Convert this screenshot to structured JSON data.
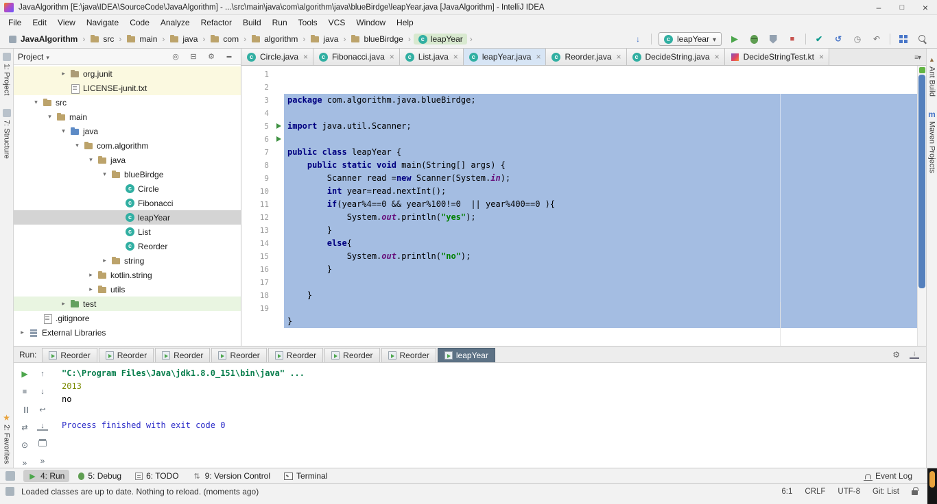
{
  "colors": {
    "selection_blue": "#A4BDE2",
    "keyword_navy": "#000080",
    "string_green": "#008000",
    "field_purple": "#660E7A",
    "run_green": "#4CA64C",
    "scrollbar_blue": "#3D6FB5",
    "active_run_tab": "#5D7285",
    "corner_orange": "#E8A33D"
  },
  "window": {
    "title": "JavaAlgorithm [E:\\java\\IDEA\\SourceCode\\JavaAlgorithm] - ...\\src\\main\\java\\com\\algorithm\\java\\blueBirdge\\leapYear.java [JavaAlgorithm] - IntelliJ IDEA"
  },
  "menu": {
    "items": [
      "File",
      "Edit",
      "View",
      "Navigate",
      "Code",
      "Analyze",
      "Refactor",
      "Build",
      "Run",
      "Tools",
      "VCS",
      "Window",
      "Help"
    ]
  },
  "toolbar": {
    "breadcrumbs": [
      {
        "label": "JavaAlgorithm",
        "icon": "project",
        "bold": true
      },
      {
        "label": "src",
        "icon": "folder"
      },
      {
        "label": "main",
        "icon": "folder"
      },
      {
        "label": "java",
        "icon": "folder"
      },
      {
        "label": "com",
        "icon": "folder"
      },
      {
        "label": "algorithm",
        "icon": "folder"
      },
      {
        "label": "java",
        "icon": "folder"
      },
      {
        "label": "blueBirdge",
        "icon": "folder"
      },
      {
        "label": "leapYear",
        "icon": "class",
        "highlight": true
      }
    ],
    "run_config": {
      "label": "leapYear"
    }
  },
  "activity_bars": {
    "left_top": [
      {
        "label": "1: Project",
        "icon": "project-tool"
      },
      {
        "label": "7: Structure",
        "icon": "structure-tool"
      }
    ],
    "left_bottom": [
      {
        "label": "2: Favorites",
        "icon": "favorites-star"
      }
    ],
    "right_top": [
      {
        "label": "Ant Build",
        "icon": "ant-tool"
      },
      {
        "label": "Maven Projects",
        "icon": "maven-tool"
      }
    ]
  },
  "project": {
    "header": "Project",
    "tree": [
      {
        "label": "org.junit",
        "depth": 3,
        "icon": "package",
        "chevron": "right",
        "row": "yellow"
      },
      {
        "label": "LICENSE-junit.txt",
        "depth": 3,
        "icon": "text-file",
        "row": "yellow"
      },
      {
        "label": "src",
        "depth": 1,
        "icon": "folder",
        "chevron": "down"
      },
      {
        "label": "main",
        "depth": 2,
        "icon": "folder",
        "chevron": "down"
      },
      {
        "label": "java",
        "depth": 3,
        "icon": "folder-source",
        "chevron": "down"
      },
      {
        "label": "com.algorithm",
        "depth": 4,
        "icon": "folder",
        "chevron": "down"
      },
      {
        "label": "java",
        "depth": 5,
        "icon": "folder",
        "chevron": "down"
      },
      {
        "label": "blueBirdge",
        "depth": 6,
        "icon": "folder",
        "chevron": "down"
      },
      {
        "label": "Circle",
        "depth": 7,
        "icon": "class"
      },
      {
        "label": "Fibonacci",
        "depth": 7,
        "icon": "class"
      },
      {
        "label": "leapYear",
        "depth": 7,
        "icon": "class",
        "selected": true
      },
      {
        "label": "List",
        "depth": 7,
        "icon": "class"
      },
      {
        "label": "Reorder",
        "depth": 7,
        "icon": "class"
      },
      {
        "label": "string",
        "depth": 6,
        "icon": "folder",
        "chevron": "right"
      },
      {
        "label": "kotlin.string",
        "depth": 5,
        "icon": "folder",
        "chevron": "right"
      },
      {
        "label": "utils",
        "depth": 5,
        "icon": "folder",
        "chevron": "right"
      },
      {
        "label": "test",
        "depth": 3,
        "icon": "folder-test",
        "chevron": "right",
        "row": "green"
      },
      {
        "label": ".gitignore",
        "depth": 1,
        "icon": "text-file"
      },
      {
        "label": "External Libraries",
        "depth": 0,
        "icon": "libraries",
        "chevron": "right"
      }
    ]
  },
  "editor": {
    "tabs": [
      {
        "label": "Circle.java",
        "icon": "java-class"
      },
      {
        "label": "Fibonacci.java",
        "icon": "java-class"
      },
      {
        "label": "List.java",
        "icon": "java-class"
      },
      {
        "label": "leapYear.java",
        "icon": "java-class",
        "active": true
      },
      {
        "label": "Reorder.java",
        "icon": "java-class"
      },
      {
        "label": "DecideString.java",
        "icon": "java-class"
      },
      {
        "label": "DecideStringTest.kt",
        "icon": "kotlin-file"
      }
    ],
    "selection_end_line": 18,
    "lines": [
      {
        "n": 1,
        "seg": [
          {
            "t": "package",
            "c": "kw"
          },
          {
            "t": " com.algorithm.java.blueBirdge;"
          }
        ]
      },
      {
        "n": 2,
        "seg": []
      },
      {
        "n": 3,
        "seg": [
          {
            "t": "import",
            "c": "kw"
          },
          {
            "t": " java.util.Scanner;"
          }
        ]
      },
      {
        "n": 4,
        "seg": []
      },
      {
        "n": 5,
        "run": true,
        "seg": [
          {
            "t": "public class",
            "c": "kw"
          },
          {
            "t": " leapYear {"
          }
        ]
      },
      {
        "n": 6,
        "run": true,
        "seg": [
          {
            "t": "    "
          },
          {
            "t": "public static void",
            "c": "kw"
          },
          {
            "t": " main(String[] args) {"
          }
        ]
      },
      {
        "n": 7,
        "seg": [
          {
            "t": "        Scanner read ="
          },
          {
            "t": "new",
            "c": "kw"
          },
          {
            "t": " Scanner(System."
          },
          {
            "t": "in",
            "c": "fld"
          },
          {
            "t": ");"
          }
        ]
      },
      {
        "n": 8,
        "seg": [
          {
            "t": "        "
          },
          {
            "t": "int",
            "c": "kw"
          },
          {
            "t": " year=read.nextInt();"
          }
        ]
      },
      {
        "n": 9,
        "seg": [
          {
            "t": "        "
          },
          {
            "t": "if",
            "c": "kw"
          },
          {
            "t": "(year%4==0 && year%100!=0  || year%400==0 ){"
          }
        ]
      },
      {
        "n": 10,
        "seg": [
          {
            "t": "            System."
          },
          {
            "t": "out",
            "c": "fld"
          },
          {
            "t": ".println("
          },
          {
            "t": "\"yes\"",
            "c": "str"
          },
          {
            "t": ");"
          }
        ]
      },
      {
        "n": 11,
        "seg": [
          {
            "t": "        }"
          }
        ]
      },
      {
        "n": 12,
        "seg": [
          {
            "t": "        "
          },
          {
            "t": "else",
            "c": "kw"
          },
          {
            "t": "{"
          }
        ]
      },
      {
        "n": 13,
        "seg": [
          {
            "t": "            System."
          },
          {
            "t": "out",
            "c": "fld"
          },
          {
            "t": ".println("
          },
          {
            "t": "\"no\"",
            "c": "str"
          },
          {
            "t": ");"
          }
        ]
      },
      {
        "n": 14,
        "seg": [
          {
            "t": "        }"
          }
        ]
      },
      {
        "n": 15,
        "seg": []
      },
      {
        "n": 16,
        "seg": [
          {
            "t": "    }"
          }
        ]
      },
      {
        "n": 17,
        "seg": []
      },
      {
        "n": 18,
        "seg": [
          {
            "t": "}"
          }
        ]
      },
      {
        "n": 19,
        "seg": []
      }
    ]
  },
  "run_panel": {
    "label": "Run:",
    "tabs": [
      {
        "label": "Reorder"
      },
      {
        "label": "Reorder"
      },
      {
        "label": "Reorder"
      },
      {
        "label": "Reorder"
      },
      {
        "label": "Reorder"
      },
      {
        "label": "Reorder"
      },
      {
        "label": "Reorder"
      },
      {
        "label": "leapYear",
        "active": true
      }
    ],
    "toolbar_left": [
      "rerun",
      "stop",
      "pause",
      "restore-layout",
      "pin",
      "more"
    ],
    "toolbar_right": [
      "prev-occurrence",
      "next-occurrence",
      "soft-wrap",
      "scroll-end",
      "print",
      "more"
    ],
    "console": [
      {
        "text": "\"C:\\Program Files\\Java\\jdk1.8.0_151\\bin\\java\" ...",
        "cls": "cmd"
      },
      {
        "text": "2013",
        "cls": "input"
      },
      {
        "text": "no",
        "cls": "out"
      },
      {
        "text": "",
        "cls": "blank"
      },
      {
        "text": "Process finished with exit code 0",
        "cls": "sys"
      }
    ]
  },
  "toolwindow_bar": {
    "items": [
      {
        "label": "4: Run",
        "icon": "run",
        "active": true
      },
      {
        "label": "5: Debug",
        "icon": "debug"
      },
      {
        "label": "6: TODO",
        "icon": "todo"
      },
      {
        "label": "9: Version Control",
        "icon": "vcs"
      },
      {
        "label": "Terminal",
        "icon": "terminal"
      }
    ],
    "event_log": {
      "label": "Event Log"
    }
  },
  "statusbar": {
    "message": "Loaded classes are up to date. Nothing to reload. (moments ago)",
    "items": [
      "6:1",
      "CRLF",
      "UTF-8",
      "Git: List"
    ]
  }
}
